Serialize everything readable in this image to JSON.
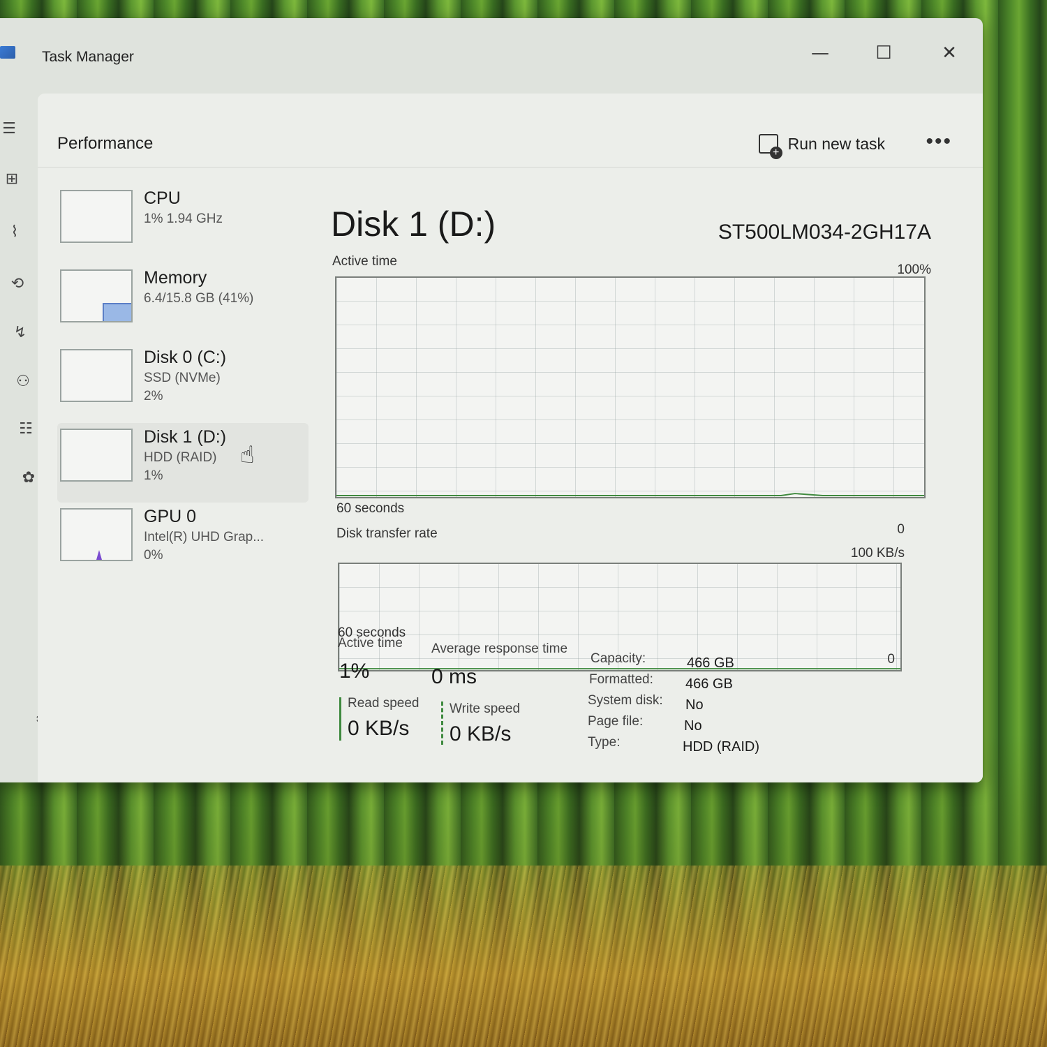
{
  "window": {
    "title": "Task Manager",
    "controls": {
      "minimize": "—",
      "maximize": "☐",
      "close": "✕"
    }
  },
  "nav_icons": [
    {
      "name": "menu-icon",
      "glyph": "☰"
    },
    {
      "name": "processes-icon",
      "glyph": "⊞"
    },
    {
      "name": "performance-icon",
      "glyph": "⌇"
    },
    {
      "name": "app-history-icon",
      "glyph": "⟲"
    },
    {
      "name": "startup-apps-icon",
      "glyph": "↯"
    },
    {
      "name": "users-icon",
      "glyph": "⚇"
    },
    {
      "name": "details-icon",
      "glyph": "☷"
    },
    {
      "name": "services-icon",
      "glyph": "✿"
    }
  ],
  "settings_icon": "⚙",
  "header": {
    "title": "Performance",
    "run_new_task": "Run new task",
    "more": "•••"
  },
  "devices": [
    {
      "name": "CPU",
      "line1": "1%  1.94 GHz",
      "line2": "",
      "selected": false,
      "graph": "flat"
    },
    {
      "name": "Memory",
      "line1": "6.4/15.8 GB (41%)",
      "line2": "",
      "selected": false,
      "graph": "memory",
      "fill_fraction": 0.41
    },
    {
      "name": "Disk 0 (C:)",
      "line1": "SSD (NVMe)",
      "line2": "2%",
      "selected": false,
      "graph": "flat"
    },
    {
      "name": "Disk 1 (D:)",
      "line1": "HDD (RAID)",
      "line2": "1%",
      "selected": true,
      "graph": "flat"
    },
    {
      "name": "GPU 0",
      "line1": "Intel(R) UHD Grap...",
      "line2": "0%",
      "selected": false,
      "graph": "gpu"
    }
  ],
  "cursor_glyph": "☝",
  "detail": {
    "title": "Disk 1 (D:)",
    "model": "ST500LM034-2GH17A",
    "active_time_chart": {
      "label": "Active time",
      "max_label": "100%",
      "time_label": "60 seconds",
      "min_label": "0"
    },
    "transfer_chart": {
      "label": "Disk transfer rate",
      "max_label": "100 KB/s",
      "time_label": "60 seconds",
      "min_label": "0"
    }
  },
  "stats": {
    "active_time_label": "Active time",
    "active_time_value": "1%",
    "avg_response_label": "Average response time",
    "avg_response_value": "0 ms",
    "read_speed_label": "Read speed",
    "read_speed_value": "0 KB/s",
    "write_speed_label": "Write speed",
    "write_speed_value": "0 KB/s",
    "read_color": "#3f8a3f",
    "write_color": "#3f8a3f"
  },
  "properties": [
    {
      "label": "Capacity:",
      "value": "466 GB"
    },
    {
      "label": "Formatted:",
      "value": "466 GB"
    },
    {
      "label": "System disk:",
      "value": "No"
    },
    {
      "label": "Page file:",
      "value": "No"
    },
    {
      "label": "Type:",
      "value": "HDD (RAID)"
    }
  ]
}
